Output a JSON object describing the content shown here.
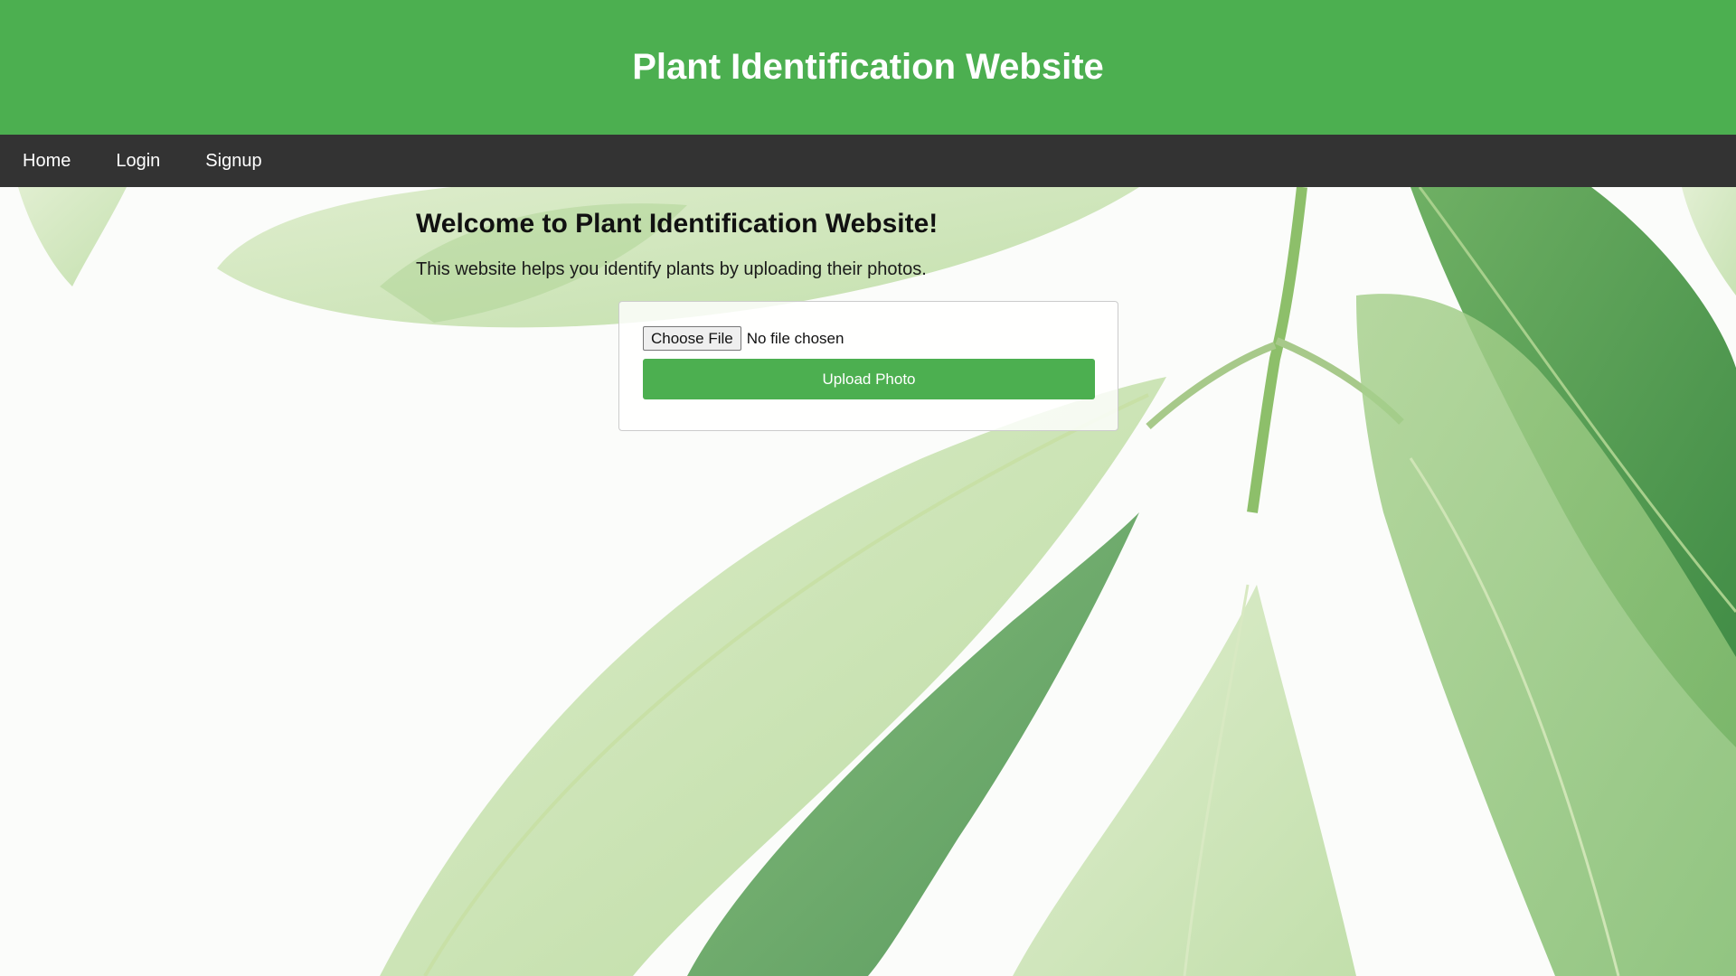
{
  "header": {
    "title": "Plant Identification Website"
  },
  "nav": {
    "items": [
      {
        "label": "Home"
      },
      {
        "label": "Login"
      },
      {
        "label": "Signup"
      }
    ]
  },
  "main": {
    "welcome_title": "Welcome to Plant Identification Website!",
    "welcome_text": "This website helps you identify plants by uploading their photos.",
    "upload": {
      "choose_file_label": "Choose File",
      "file_status": "No file chosen",
      "upload_button_label": "Upload Photo"
    }
  },
  "colors": {
    "header_bg": "#4caf50",
    "nav_bg": "#333333",
    "button_bg": "#4caf50",
    "leaf_light": "#c9e3b4",
    "leaf_dark": "#4e9a4b"
  },
  "icons": {
    "background": "leaf-photo-image"
  }
}
